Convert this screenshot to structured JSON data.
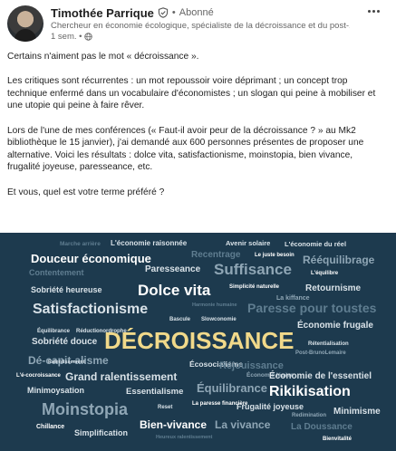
{
  "author": {
    "name": "Timothée Parrique",
    "follow_status": "Abonné",
    "separator": "•",
    "headline": "Chercheur en économie écologique, spécialiste de la décroissance et du post-...",
    "time": "1 sem. •"
  },
  "icons": {
    "verified": "verified-shield-icon",
    "globe": "globe-icon",
    "more": "more-options-icon"
  },
  "post": {
    "paragraphs": [
      "Certains n'aiment pas le mot « décroissance ».",
      "Les critiques sont récurrentes : un mot repoussoir voire déprimant ; un concept trop technique enfermé dans un vocabulaire d'économistes ; un slogan qui peine à mobiliser et une utopie qui peine à faire rêver.",
      "Lors de l'une de mes conférences (« Faut-il avoir peur de la décroissance ? » au Mk2 bibliothèque le 15 janvier), j'ai demandé aux 600 personnes présentes de proposer une alternative. Voici les résultats : dolce vita, satisfactionisme, moinstopia, bien vivance, frugalité joyeuse, paresseance, etc.",
      "Et vous, quel est votre terme préféré ?"
    ]
  },
  "colors": {
    "cloud_background": "#1d3a4e",
    "word_white": "#ffffff",
    "word_light": "#d9e2e8",
    "word_muted": "#8fa6b5",
    "word_dim": "#5f7d90",
    "word_yellow": "#f1d98a"
  },
  "wordcloud": {
    "words": [
      {
        "text": "Marche arrière",
        "color": "#5f7d90"
      },
      {
        "text": "L'économie raisonnée",
        "color": "#d9e2e8"
      },
      {
        "text": "Avenir solaire",
        "color": "#d9e2e8"
      },
      {
        "text": "L'économie du réel",
        "color": "#d9e2e8"
      },
      {
        "text": "Douceur économique",
        "color": "#ffffff"
      },
      {
        "text": "Recentrage",
        "color": "#5f7d90"
      },
      {
        "text": "Le juste besoin",
        "color": "#ffffff"
      },
      {
        "text": "Rééquilibrage",
        "color": "#8fa6b5"
      },
      {
        "text": "Contentement",
        "color": "#5f7d90"
      },
      {
        "text": "Paresseance",
        "color": "#d9e2e8"
      },
      {
        "text": "Suffisance",
        "color": "#8fa6b5"
      },
      {
        "text": "L'équilibre",
        "color": "#ffffff"
      },
      {
        "text": "Sobriété heureuse",
        "color": "#d9e2e8"
      },
      {
        "text": "Dolce vita",
        "color": "#ffffff"
      },
      {
        "text": "Simplicité naturelle",
        "color": "#ffffff"
      },
      {
        "text": "Retournisme",
        "color": "#d9e2e8"
      },
      {
        "text": "La kiffance",
        "color": "#8fa6b5"
      },
      {
        "text": "Satisfactionisme",
        "color": "#d9e2e8"
      },
      {
        "text": "Harmonie humaine",
        "color": "#5f7d90"
      },
      {
        "text": "Paresse pour toustes",
        "color": "#5f7d90"
      },
      {
        "text": "Bascule",
        "color": "#d9e2e8"
      },
      {
        "text": "Slowconomie",
        "color": "#d9e2e8"
      },
      {
        "text": "Équilibrance",
        "color": "#d9e2e8"
      },
      {
        "text": "Réductionordrophe",
        "color": "#d9e2e8"
      },
      {
        "text": "Économie frugale",
        "color": "#d9e2e8"
      },
      {
        "text": "DÉCROISSANCE",
        "color": "#f1d98a"
      },
      {
        "text": "Sobriété douce",
        "color": "#d9e2e8"
      },
      {
        "text": "Rétentialisation",
        "color": "#d9e2e8"
      },
      {
        "text": "Dé-capit-alisme",
        "color": "#8fa6b5"
      },
      {
        "text": "Post-BrunoLemaire",
        "color": "#8fa6b5"
      },
      {
        "text": "Ralentissement",
        "color": "#d9e2e8"
      },
      {
        "text": "Écosocialisme",
        "color": "#d9e2e8"
      },
      {
        "text": "Réjouissance",
        "color": "#5f7d90"
      },
      {
        "text": "L'é-cocroissance",
        "color": "#ffffff"
      },
      {
        "text": "Grand ralentissement",
        "color": "#d9e2e8"
      },
      {
        "text": "Économie légère",
        "color": "#8fa6b5"
      },
      {
        "text": "Économie de l'essentiel",
        "color": "#d9e2e8"
      },
      {
        "text": "Minimoysation",
        "color": "#d9e2e8"
      },
      {
        "text": "Essentialisme",
        "color": "#d9e2e8"
      },
      {
        "text": "Équilibrance",
        "color": "#8fa6b5"
      },
      {
        "text": "Rikikisation",
        "color": "#ffffff"
      },
      {
        "text": "Moinstopia",
        "color": "#8fa6b5"
      },
      {
        "text": "Reset",
        "color": "#d9e2e8"
      },
      {
        "text": "La paresse financière",
        "color": "#ffffff"
      },
      {
        "text": "Frugalité joyeuse",
        "color": "#d9e2e8"
      },
      {
        "text": "Redimination",
        "color": "#8fa6b5"
      },
      {
        "text": "Minimisme",
        "color": "#d9e2e8"
      },
      {
        "text": "Chillance",
        "color": "#ffffff"
      },
      {
        "text": "Bien-vivance",
        "color": "#ffffff"
      },
      {
        "text": "La vivance",
        "color": "#8fa6b5"
      },
      {
        "text": "La Doussance",
        "color": "#5f7d90"
      },
      {
        "text": "Simplification",
        "color": "#d9e2e8"
      },
      {
        "text": "Heureux ralentissement",
        "color": "#5f7d90"
      },
      {
        "text": "Bienvitalité",
        "color": "#ffffff"
      }
    ]
  }
}
